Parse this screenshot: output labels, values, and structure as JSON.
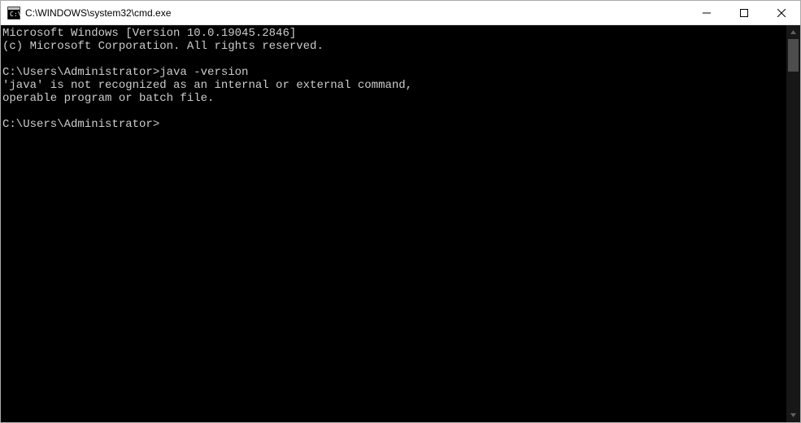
{
  "window": {
    "title": "C:\\WINDOWS\\system32\\cmd.exe"
  },
  "terminal": {
    "lines": [
      "Microsoft Windows [Version 10.0.19045.2846]",
      "(c) Microsoft Corporation. All rights reserved.",
      "",
      "C:\\Users\\Administrator>java -version",
      "'java' is not recognized as an internal or external command,",
      "operable program or batch file.",
      "",
      "C:\\Users\\Administrator>"
    ]
  }
}
